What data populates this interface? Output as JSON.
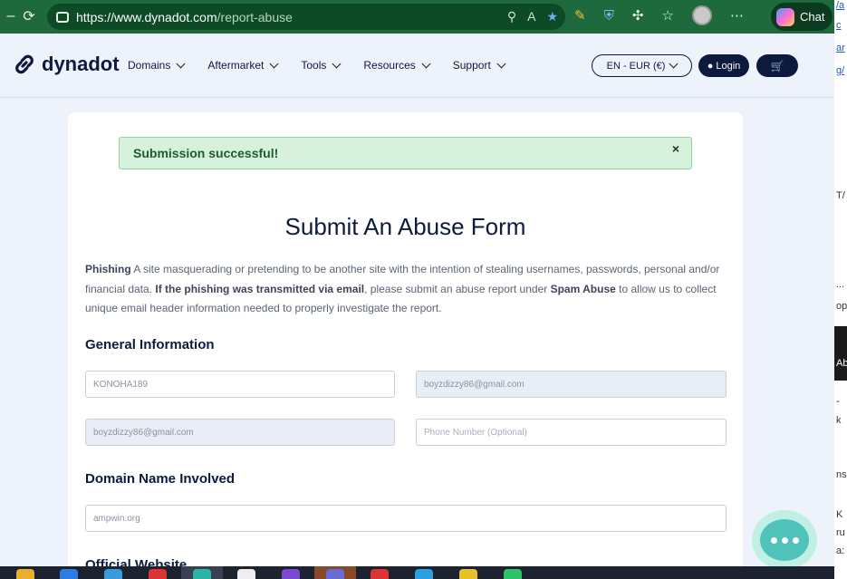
{
  "browser": {
    "url_host": "https://www.dynadot.com",
    "url_path": "/report-abuse",
    "chat_label": "Chat"
  },
  "side_window": {
    "fragments": [
      "/a",
      "c",
      "ar",
      "g/",
      "T/",
      "...",
      "op",
      "Ab",
      "-",
      "k",
      "ns",
      "K",
      "ru",
      "a:"
    ]
  },
  "site": {
    "logo_text": "dynadot",
    "menu": [
      "Domains",
      "Aftermarket",
      "Tools",
      "Resources",
      "Support"
    ],
    "currency": "EN - EUR (€)",
    "login": "Login"
  },
  "alert": {
    "message": "Submission successful!",
    "close": "×"
  },
  "form": {
    "title": "Submit An Abuse Form",
    "desc_term": "Phishing",
    "desc_text1": " A site masquerading or pretending to be another site with the intention of stealing usernames, passwords, personal and/or financial data. ",
    "desc_bold2": "If the phishing was transmitted via email",
    "desc_text2": ", please submit an abuse report under ",
    "desc_bold3": "Spam Abuse",
    "desc_text3": " to allow us to collect unique email header information needed to properly investigate the report.",
    "general_heading": "General Information",
    "name_value": "KONOHA189",
    "email_value": "boyzdizzy86@gmail.com",
    "email_confirm_value": "boyzdizzy86@gmail.com",
    "phone_placeholder": "Phone Number (Optional)",
    "domain_heading": "Domain Name Involved",
    "domain_value": "ampwin.org",
    "official_heading": "Official Website"
  },
  "colors": {
    "brand_navy": "#0c1a3d",
    "success_bg": "#d6f2dc",
    "browser_green": "#1e6a3c",
    "chat_teal": "#4fc3b9"
  }
}
